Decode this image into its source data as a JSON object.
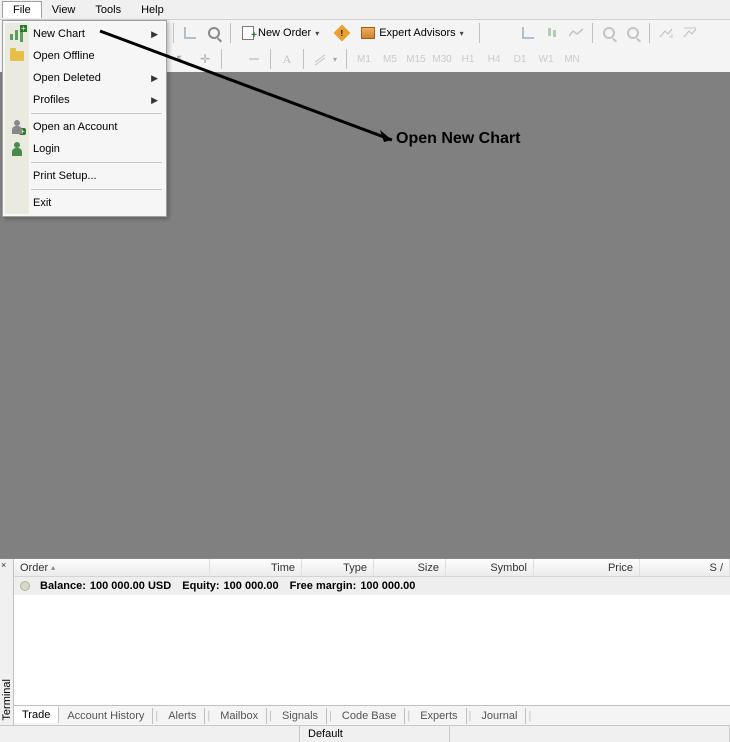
{
  "menubar": {
    "file": "File",
    "view": "View",
    "tools": "Tools",
    "help": "Help"
  },
  "file_menu": {
    "new_chart": "New Chart",
    "open_offline": "Open Offline",
    "open_deleted": "Open Deleted",
    "profiles": "Profiles",
    "open_account": "Open an Account",
    "login": "Login",
    "print_setup": "Print Setup...",
    "exit": "Exit"
  },
  "toolbar": {
    "new_order": "New Order",
    "expert_advisors": "Expert Advisors"
  },
  "timeframes": {
    "m1": "M1",
    "m5": "M5",
    "m15": "M15",
    "m30": "M30",
    "h1": "H1",
    "h4": "H4",
    "d1": "D1",
    "w1": "W1",
    "mn": "MN"
  },
  "annotation": "Open New Chart",
  "terminal": {
    "label": "Terminal",
    "columns": {
      "order": "Order",
      "time": "Time",
      "type": "Type",
      "size": "Size",
      "symbol": "Symbol",
      "price": "Price",
      "sl": "S /"
    },
    "balance_label": "Balance:",
    "balance_value": "100 000.00 USD",
    "equity_label": "Equity:",
    "equity_value": "100 000.00",
    "free_margin_label": "Free margin:",
    "free_margin_value": "100 000.00",
    "tabs": {
      "trade": "Trade",
      "account_history": "Account History",
      "alerts": "Alerts",
      "mailbox": "Mailbox",
      "signals": "Signals",
      "code_base": "Code Base",
      "experts": "Experts",
      "journal": "Journal"
    }
  },
  "statusbar": {
    "default": "Default"
  },
  "tool_letters": {
    "a": "A"
  }
}
